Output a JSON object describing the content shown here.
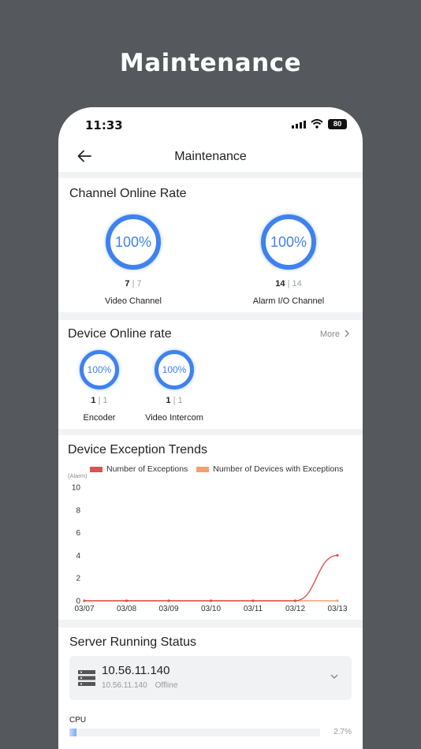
{
  "banner_title": "Maintenance",
  "status_bar": {
    "time": "11:33",
    "battery": "80"
  },
  "navbar": {
    "title": "Maintenance"
  },
  "channel_online": {
    "title": "Channel Online Rate",
    "items": [
      {
        "percent": "100%",
        "online": "7",
        "separator": "|",
        "total": "7",
        "label": "Video Channel"
      },
      {
        "percent": "100%",
        "online": "14",
        "separator": "|",
        "total": "14",
        "label": "Alarm I/O Channel"
      }
    ]
  },
  "device_online": {
    "title": "Device Online rate",
    "more_label": "More",
    "items": [
      {
        "percent": "100%",
        "online": "1",
        "separator": "|",
        "total": "1",
        "label": "Encoder"
      },
      {
        "percent": "100%",
        "online": "1",
        "separator": "|",
        "total": "1",
        "label": "Video Intercom"
      }
    ]
  },
  "exception_trends": {
    "title": "Device Exception Trends",
    "legend": [
      {
        "label": "Number of Exceptions",
        "color": "#d9534f"
      },
      {
        "label": "Number of Devices with Exceptions",
        "color": "#f0a070"
      }
    ]
  },
  "chart_data": {
    "type": "line",
    "ylabel": "(Alarm)",
    "ylim": [
      0,
      10
    ],
    "y_ticks": [
      "10",
      "8",
      "6",
      "4",
      "2",
      "0"
    ],
    "categories": [
      "03/07",
      "03/08",
      "03/09",
      "03/10",
      "03/11",
      "03/12",
      "03/13"
    ],
    "series": [
      {
        "name": "Number of Exceptions",
        "color": "#d9534f",
        "values": [
          0,
          0,
          0,
          0,
          0,
          0,
          4
        ]
      },
      {
        "name": "Number of Devices with Exceptions",
        "color": "#f0a070",
        "values": [
          0,
          0,
          0,
          0,
          0,
          0,
          0
        ]
      }
    ],
    "grid": false,
    "legend_position": "top"
  },
  "server_status": {
    "title": "Server Running Status",
    "server": {
      "ip": "10.56.11.140",
      "sub_ip": "10.56.11.140",
      "state": "Offline"
    },
    "cpu": {
      "label": "CPU",
      "value_text": "2.7%",
      "fraction": 0.027
    }
  },
  "colors": {
    "accent": "#3f82ed",
    "background": "#55585c"
  }
}
